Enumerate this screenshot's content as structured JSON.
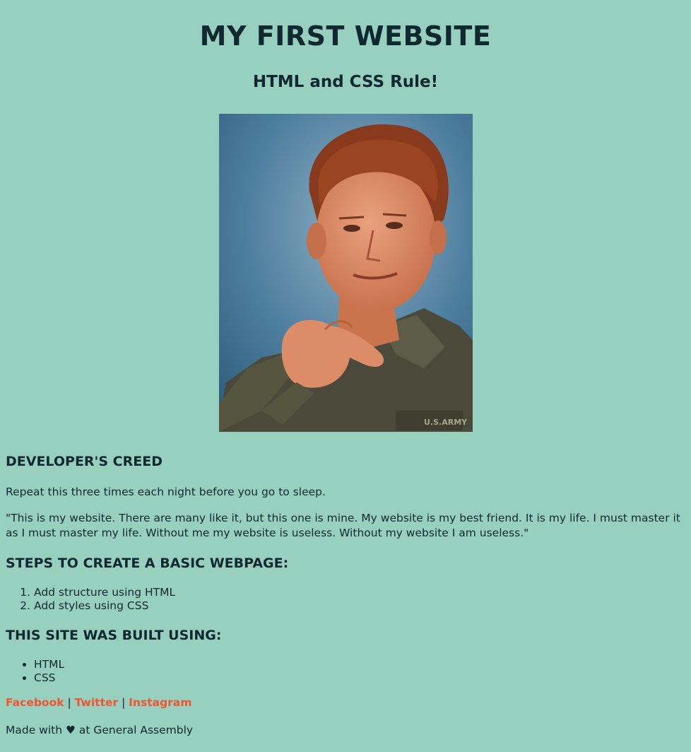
{
  "header": {
    "title": "MY FIRST WEBSITE",
    "subtitle": "HTML and CSS Rule!"
  },
  "creed": {
    "heading": "DEVELOPER'S CREED",
    "intro": "Repeat this three times each night before you go to sleep.",
    "quote": "\"This is my website. There are many like it, but this one is mine. My website is my best friend. It is my life. I must master it as I must master my life. Without me my website is useless. Without my website I am useless.\""
  },
  "steps": {
    "heading": "STEPS TO CREATE A BASIC WEBPAGE:",
    "items": [
      "Add structure using HTML",
      "Add styles using CSS"
    ]
  },
  "built": {
    "heading": "THIS SITE WAS BUILT USING:",
    "items": [
      "HTML",
      "CSS"
    ]
  },
  "social": {
    "facebook": "Facebook",
    "twitter": "Twitter",
    "instagram": "Instagram",
    "separator": "|"
  },
  "footer": {
    "made_prefix": "Made with",
    "heart_icon": "heart-icon",
    "made_suffix": "at General Assembly"
  },
  "colors": {
    "background": "#97d0bf",
    "text": "#10282f",
    "link": "#f0552f"
  }
}
